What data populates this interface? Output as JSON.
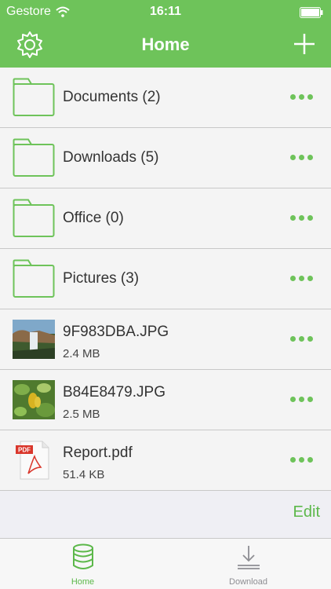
{
  "status_bar": {
    "carrier": "Gestore",
    "time": "16:11"
  },
  "nav": {
    "title": "Home"
  },
  "items": [
    {
      "kind": "folder",
      "name": "Documents (2)"
    },
    {
      "kind": "folder",
      "name": "Downloads (5)"
    },
    {
      "kind": "folder",
      "name": "Office (0)"
    },
    {
      "kind": "folder",
      "name": "Pictures (3)"
    },
    {
      "kind": "image",
      "name": "9F983DBA.JPG",
      "size": "2.4 MB"
    },
    {
      "kind": "image",
      "name": "B84E8479.JPG",
      "size": "2.5 MB"
    },
    {
      "kind": "pdf",
      "name": "Report.pdf",
      "size": "51.4 KB",
      "badge": "PDF"
    }
  ],
  "edit_label": "Edit",
  "tabs": [
    {
      "label": "Home",
      "icon": "database-icon",
      "active": true
    },
    {
      "label": "Download",
      "icon": "download-icon",
      "active": false
    }
  ],
  "colors": {
    "accent": "#6ec35a",
    "background": "#efeff4"
  }
}
